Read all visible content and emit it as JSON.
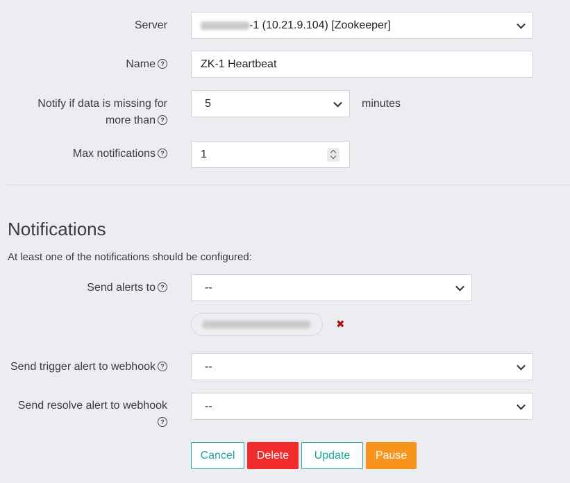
{
  "server": {
    "label": "Server",
    "value_suffix": "-1 (10.21.9.104) [Zookeeper]"
  },
  "name": {
    "label": "Name",
    "value": "ZK-1 Heartbeat"
  },
  "notify_missing": {
    "label_line1": "Notify if data is missing for",
    "label_line2": "more than",
    "value": "5",
    "unit": "minutes"
  },
  "max_notifications": {
    "label": "Max notifications",
    "value": "1"
  },
  "notifications": {
    "heading": "Notifications",
    "description": "At least one of the notifications should be configured:",
    "send_alerts_label": "Send alerts to",
    "send_alerts_value": "--",
    "trigger_webhook_label": "Send trigger alert to webhook",
    "trigger_webhook_value": "--",
    "resolve_webhook_label": "Send resolve alert to webhook",
    "resolve_webhook_value": "--",
    "remove_symbol": "✖"
  },
  "buttons": {
    "cancel": "Cancel",
    "delete": "Delete",
    "update": "Update",
    "pause": "Pause"
  },
  "help_symbol": "?",
  "colors": {
    "background": "#ecedf1",
    "accent_teal": "#1aa79a",
    "danger_red": "#ef2b2b",
    "pause_orange": "#f7941d",
    "remove_x": "#b01010"
  }
}
